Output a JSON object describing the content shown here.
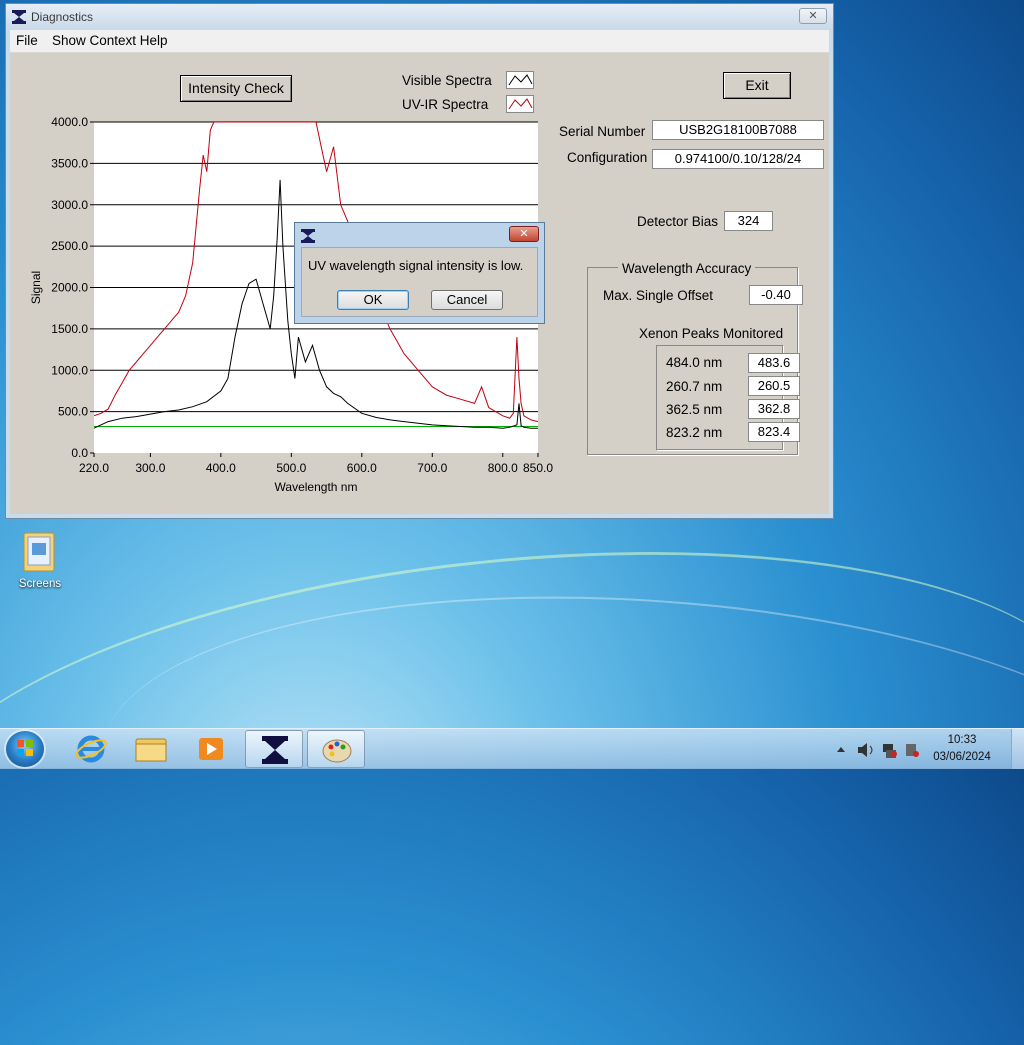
{
  "window": {
    "title": "Diagnostics",
    "menu": [
      "File",
      "Show Context Help"
    ]
  },
  "buttons": {
    "intensity_check": "Intensity Check",
    "exit": "Exit"
  },
  "legend": {
    "visible": "Visible Spectra",
    "uvir": "UV-IR Spectra"
  },
  "info": {
    "serial_label": "Serial Number",
    "serial_value": "USB2G18100B7088",
    "config_label": "Configuration",
    "config_value": "0.974100/0.10/128/24",
    "bias_label": "Detector Bias",
    "bias_value": "324"
  },
  "wavelength_accuracy": {
    "group_label": "Wavelength Accuracy",
    "offset_label": "Max. Single Offset",
    "offset_value": "-0.40",
    "peaks_label": "Xenon Peaks Monitored",
    "peaks": [
      {
        "nominal": "484.0 nm",
        "measured": "483.6"
      },
      {
        "nominal": "260.7 nm",
        "measured": "260.5"
      },
      {
        "nominal": "362.5 nm",
        "measured": "362.8"
      },
      {
        "nominal": "823.2 nm",
        "measured": "823.4"
      }
    ]
  },
  "dialog": {
    "message": "UV wavelength signal intensity is  low.",
    "ok": "OK",
    "cancel": "Cancel"
  },
  "desktop": {
    "icon_label": "Screens"
  },
  "taskbar": {
    "time": "10:33",
    "date": "03/06/2024"
  },
  "chart_data": {
    "type": "line",
    "xlabel": "Wavelength nm",
    "ylabel": "Signal",
    "xlim": [
      220,
      850
    ],
    "ylim": [
      0,
      4000
    ],
    "xticks": [
      "220.0",
      "300.0",
      "400.0",
      "500.0",
      "600.0",
      "700.0",
      "800.0",
      "850.0"
    ],
    "yticks": [
      "0.0",
      "500.0",
      "1000.0",
      "1500.0",
      "2000.0",
      "2500.0",
      "3000.0",
      "3500.0",
      "4000.0"
    ],
    "series": [
      {
        "name": "Visible Spectra",
        "color": "#000000",
        "x": [
          220,
          240,
          260,
          280,
          300,
          320,
          340,
          360,
          380,
          400,
          410,
          420,
          430,
          440,
          450,
          460,
          470,
          475,
          480,
          484,
          488,
          495,
          500,
          505,
          510,
          520,
          530,
          540,
          550,
          560,
          570,
          580,
          600,
          620,
          640,
          660,
          680,
          700,
          720,
          740,
          760,
          780,
          800,
          810,
          820,
          823,
          826,
          830,
          840,
          850
        ],
        "y": [
          300,
          380,
          420,
          440,
          470,
          500,
          520,
          560,
          620,
          750,
          900,
          1400,
          1800,
          2050,
          2100,
          1800,
          1500,
          1900,
          2600,
          3300,
          2500,
          1600,
          1200,
          900,
          1400,
          1100,
          1300,
          1000,
          800,
          720,
          680,
          600,
          480,
          430,
          400,
          380,
          360,
          340,
          330,
          320,
          310,
          310,
          300,
          310,
          340,
          600,
          330,
          310,
          300,
          300
        ]
      },
      {
        "name": "UV-IR Spectra",
        "color": "#c00010",
        "x": [
          220,
          230,
          240,
          250,
          260,
          270,
          280,
          290,
          300,
          310,
          320,
          330,
          340,
          350,
          360,
          370,
          375,
          380,
          385,
          390,
          395,
          400,
          410,
          420,
          430,
          440,
          450,
          470,
          490,
          500,
          510,
          520,
          530,
          535,
          540,
          545,
          550,
          560,
          570,
          580,
          590,
          600,
          620,
          640,
          660,
          680,
          700,
          720,
          740,
          760,
          770,
          780,
          800,
          810,
          815,
          820,
          823,
          826,
          830,
          840,
          850
        ],
        "y": [
          450,
          480,
          530,
          700,
          850,
          1000,
          1100,
          1200,
          1300,
          1400,
          1500,
          1600,
          1700,
          1900,
          2300,
          3200,
          3600,
          3400,
          3900,
          4000,
          4000,
          4000,
          4000,
          4000,
          4000,
          4000,
          4000,
          4000,
          4000,
          4000,
          4000,
          4000,
          4000,
          4000,
          3800,
          3600,
          3400,
          3700,
          3000,
          2800,
          2600,
          2300,
          1900,
          1500,
          1200,
          1000,
          800,
          700,
          650,
          600,
          800,
          550,
          450,
          420,
          480,
          1400,
          900,
          600,
          450,
          400,
          380
        ]
      },
      {
        "name": "",
        "color": "#00b000",
        "x": [
          220,
          850
        ],
        "y": [
          320,
          320
        ]
      }
    ]
  }
}
